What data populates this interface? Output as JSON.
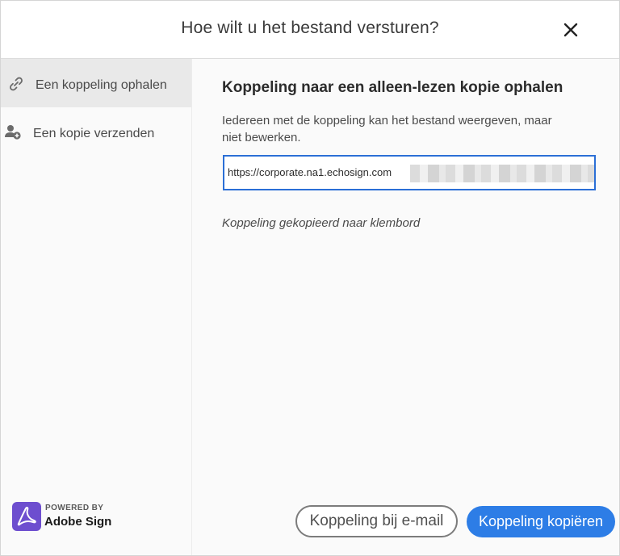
{
  "dialog": {
    "title": "Hoe wilt u het bestand versturen?",
    "close_icon": "close-icon"
  },
  "sidebar": {
    "items": [
      {
        "label": "Een koppeling ophalen",
        "icon": "link-icon",
        "active": true
      },
      {
        "label": "Een kopie verzenden",
        "icon": "add-user-icon",
        "active": false
      }
    ],
    "brand": {
      "powered_by": "POWERED BY",
      "name": "Adobe Sign",
      "icon": "adobe-acrobat-logo-icon"
    }
  },
  "main": {
    "heading": "Koppeling naar een alleen-lezen kopie ophalen",
    "description": "Iedereen met de koppeling kan het bestand weergeven, maar niet bewerken.",
    "url_value": "https://corporate.na1.echosign.com",
    "copied_note": "Koppeling gekopieerd naar klembord",
    "buttons": {
      "email": "Koppeling bij e-mail",
      "copy": "Koppeling kopiëren"
    }
  },
  "colors": {
    "accent": "#2d7de6",
    "field_border": "#2b6fd6",
    "brand": "#6d4ecf"
  }
}
